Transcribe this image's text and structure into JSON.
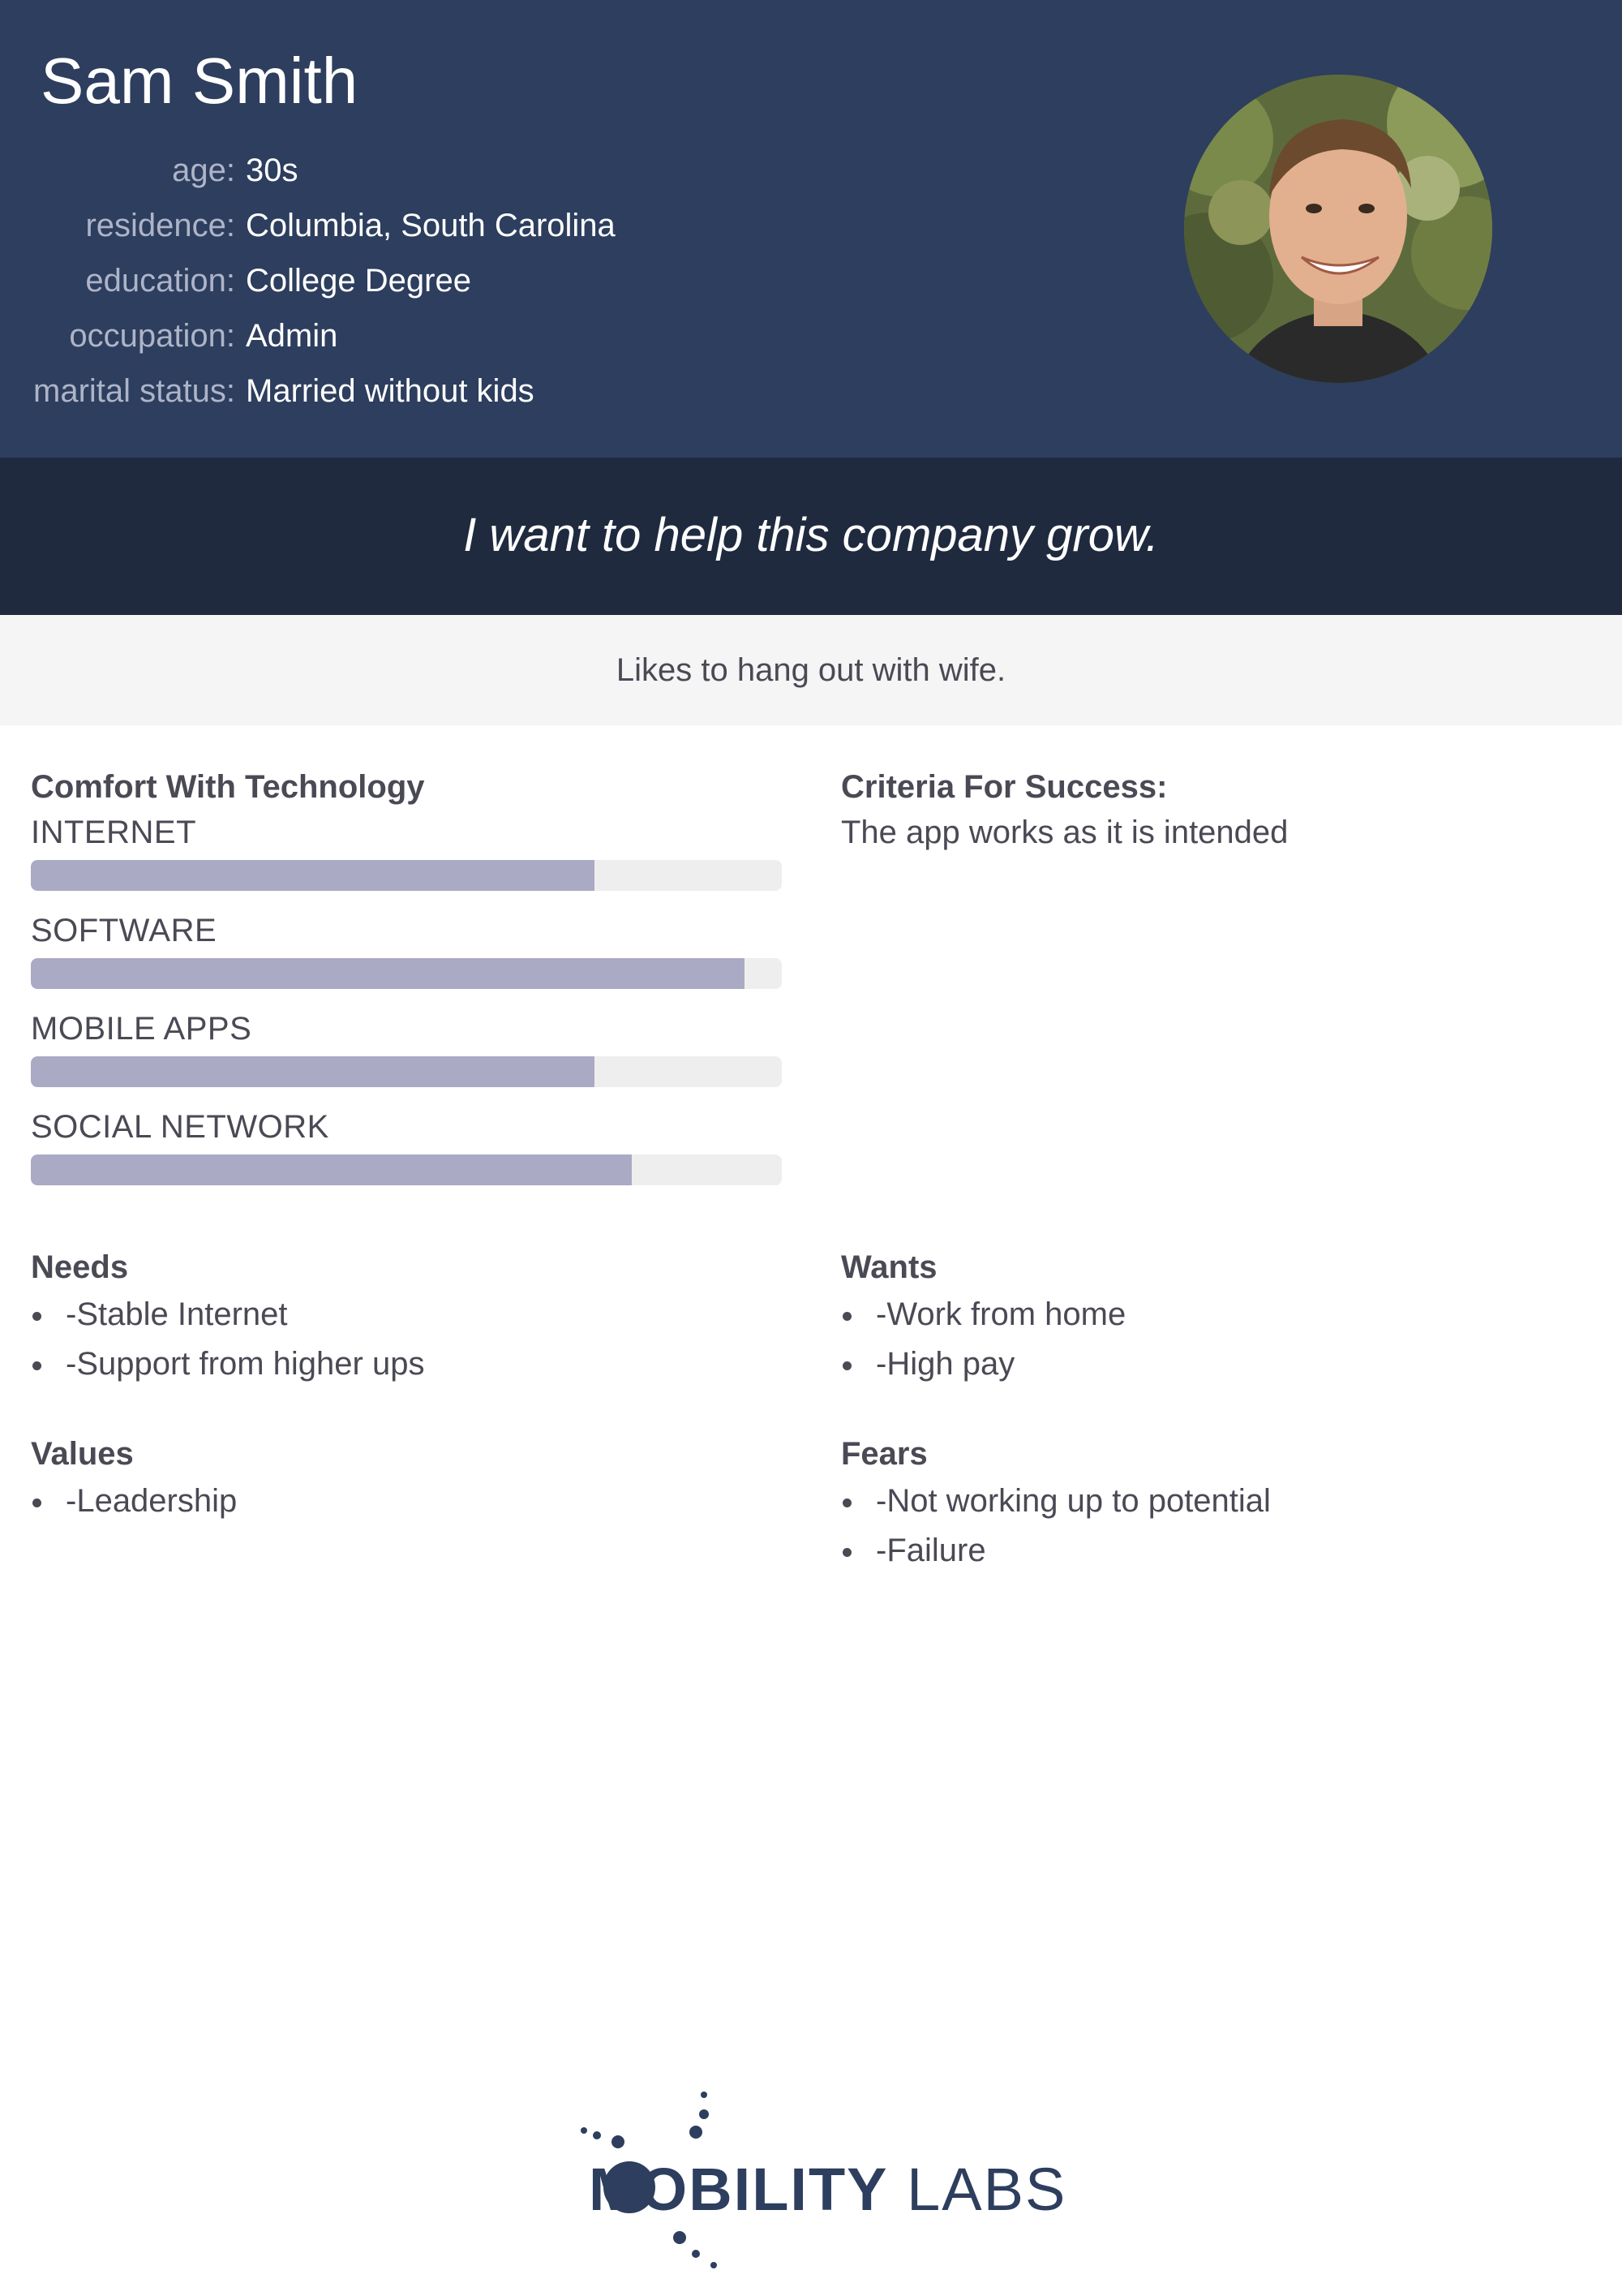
{
  "persona": {
    "name": "Sam Smith",
    "details": [
      {
        "label": "age:",
        "value": "30s"
      },
      {
        "label": "residence:",
        "value": "Columbia, South Carolina"
      },
      {
        "label": "education:",
        "value": "College Degree"
      },
      {
        "label": "occupation:",
        "value": "Admin"
      },
      {
        "label": "marital status:",
        "value": "Married without kids"
      }
    ],
    "quote": "I want to help this company grow.",
    "bio": "Likes to hang out with wife."
  },
  "comfort": {
    "title": "Comfort With Technology",
    "items": [
      {
        "label": "INTERNET",
        "level": 0.75
      },
      {
        "label": "SOFTWARE",
        "level": 0.95
      },
      {
        "label": "MOBILE APPS",
        "level": 0.75
      },
      {
        "label": "SOCIAL NETWORK",
        "level": 0.8
      }
    ]
  },
  "criteria": {
    "title": "Criteria For Success:",
    "text": "The app works as it is intended"
  },
  "needs": {
    "title": "Needs",
    "items": [
      "-Stable Internet",
      "-Support from higher ups"
    ]
  },
  "wants": {
    "title": "Wants",
    "items": [
      "-Work from home",
      "-High pay"
    ]
  },
  "values": {
    "title": "Values",
    "items": [
      "-Leadership"
    ]
  },
  "fears": {
    "title": "Fears",
    "items": [
      "-Not working up to potential",
      "-Failure"
    ]
  },
  "logo": {
    "bold_text": "MOBILITY",
    "light_text": "LABS"
  },
  "colors": {
    "header_bg": "#2d3e5e",
    "quote_bg": "#1f2a3f",
    "bar_fill": "#aaaac4",
    "bar_track": "#eeeeee"
  }
}
